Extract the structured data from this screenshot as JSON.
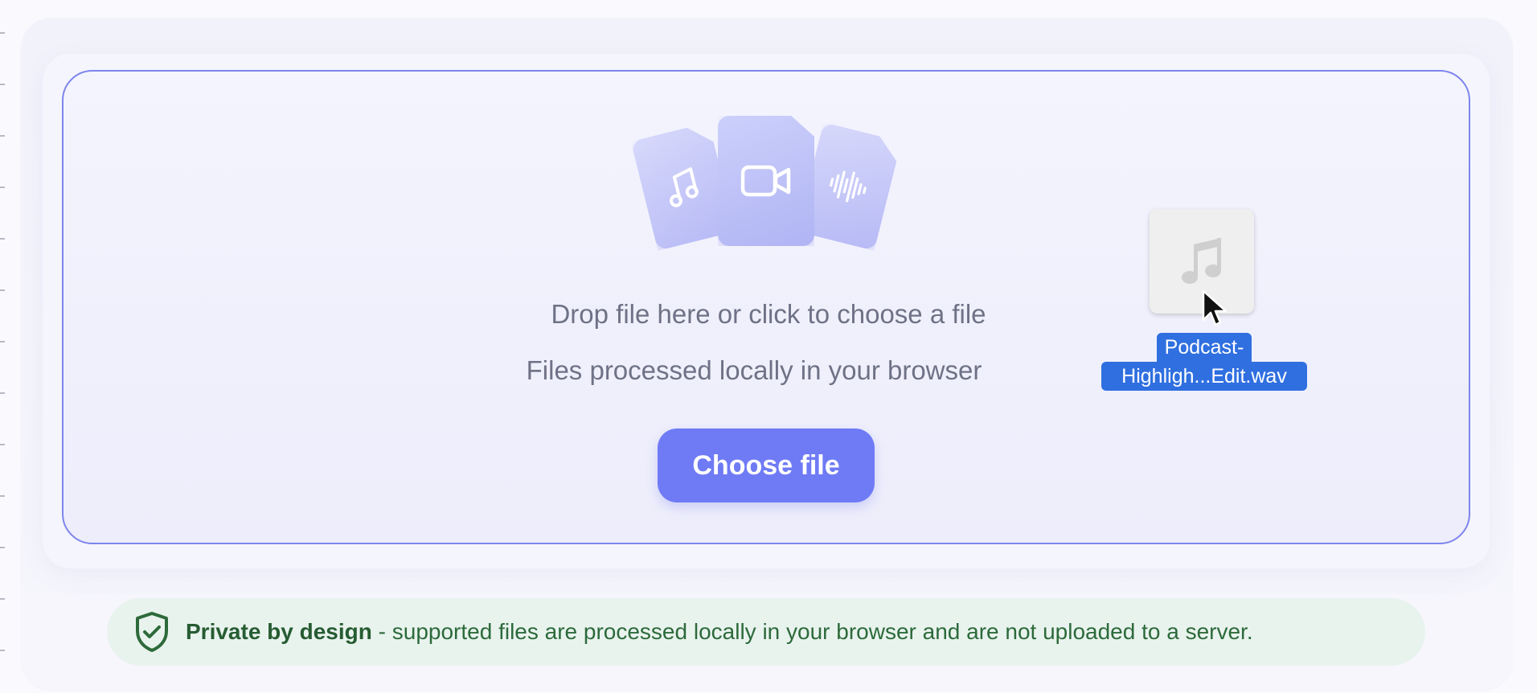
{
  "dropzone": {
    "primary_text": "Drop file here or click to choose a file",
    "secondary_text": "Files processed locally in your browser",
    "button_label": "Choose file",
    "file_type_icons": [
      "music-note-icon",
      "video-camera-icon",
      "audio-waveform-icon"
    ]
  },
  "drag_ghost": {
    "icon": "music-note-icon",
    "filename_line1": "Podcast-",
    "filename_line2": "Highligh...Edit.wav"
  },
  "privacy": {
    "title": "Private by design",
    "text": " - supported files are processed locally in your browser and are not uploaded to a server.",
    "icon": "shield-check-icon"
  },
  "colors": {
    "accent": "#6f7bf5",
    "dropzone_border": "#7d85ec",
    "privacy_bg": "#e9f3ee",
    "privacy_text": "#2c6a3a",
    "selection_blue": "#2f6fe0"
  }
}
